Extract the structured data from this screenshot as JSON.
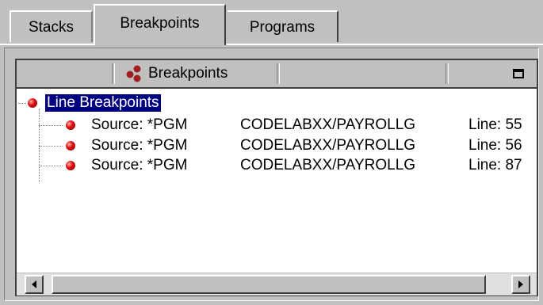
{
  "tabs": [
    {
      "label": "Stacks"
    },
    {
      "label": "Breakpoints",
      "selected": true
    },
    {
      "label": "Programs"
    }
  ],
  "panel": {
    "title": "Breakpoints",
    "icon": "breakpoints-cluster-icon"
  },
  "tree": {
    "root_label": "Line Breakpoints",
    "items": [
      {
        "source": "Source: *PGM",
        "path": "CODELABXX/PAYROLLG",
        "line": "Line: 55"
      },
      {
        "source": "Source: *PGM",
        "path": "CODELABXX/PAYROLLG",
        "line": "Line: 56"
      },
      {
        "source": "Source: *PGM",
        "path": "CODELABXX/PAYROLLG",
        "line": "Line: 87"
      }
    ]
  },
  "colors": {
    "selection": "#000080",
    "breakpoint": "#e01010",
    "chrome": "#c0c0c0"
  }
}
